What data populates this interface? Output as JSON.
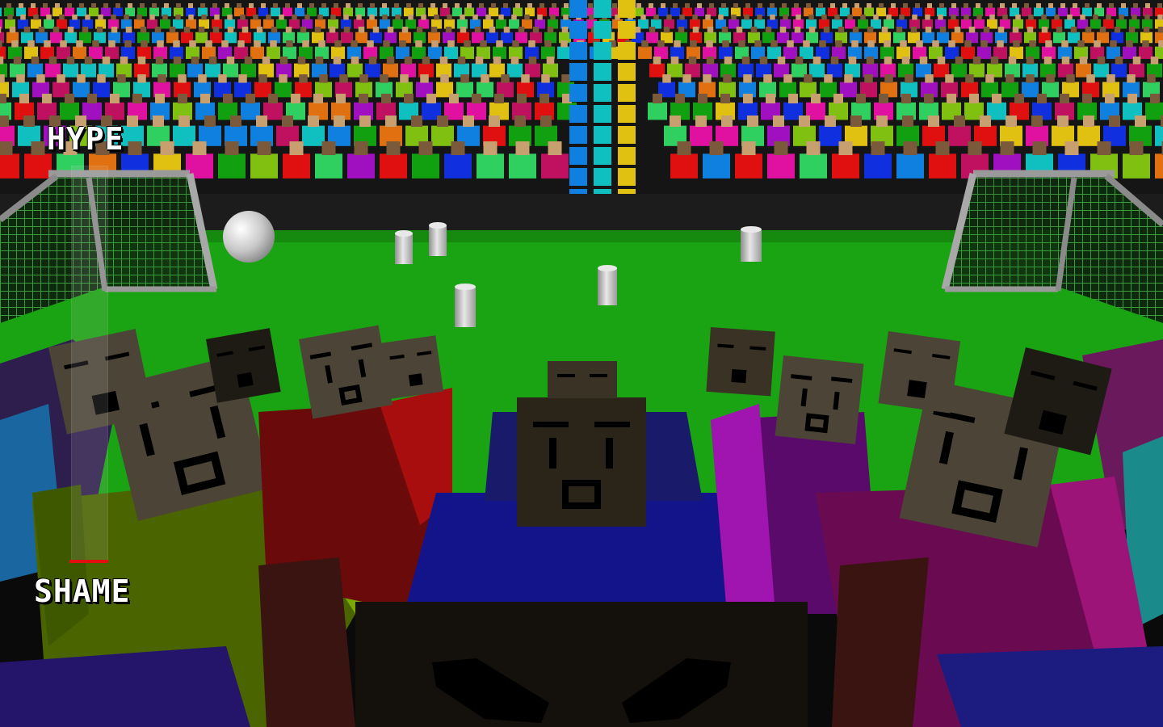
{
  "hud": {
    "hype_label": "HYPE",
    "shame_label": "SHAME",
    "meter_level": 0.0,
    "meter_marker_color": "#e01010"
  },
  "scene": {
    "pitch_color": "#1aa312",
    "goal_net_color": "#2d7a2d",
    "ball": "soccer-ball",
    "ball_color": "#d8d8d8",
    "pillar_color": "#c8c8c8"
  }
}
